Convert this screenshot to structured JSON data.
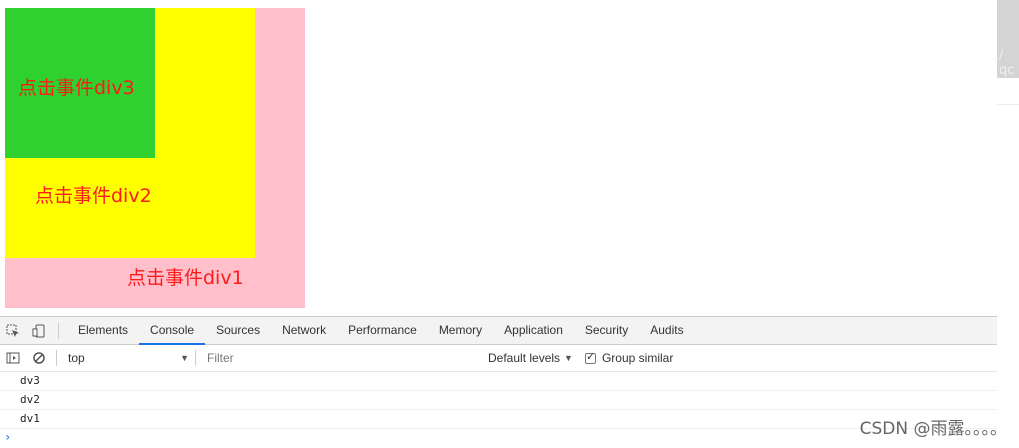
{
  "page": {
    "div3_label": "点击事件div3",
    "div2_label": "点击事件div2",
    "div1_label": "点击事件div1",
    "side_text": "/ qc"
  },
  "devtools": {
    "tabs": [
      {
        "label": "Elements"
      },
      {
        "label": "Console",
        "active": true
      },
      {
        "label": "Sources"
      },
      {
        "label": "Network"
      },
      {
        "label": "Performance"
      },
      {
        "label": "Memory"
      },
      {
        "label": "Application"
      },
      {
        "label": "Security"
      },
      {
        "label": "Audits"
      }
    ],
    "toolbar": {
      "context": "top",
      "filter_placeholder": "Filter",
      "levels": "Default levels",
      "group_similar": "Group similar"
    },
    "log": [
      "dv3",
      "dv2",
      "dv1"
    ],
    "prompt": "›"
  },
  "watermark": "CSDN @雨露。。。。",
  "colors": {
    "div1": "#ffc0cb",
    "div2": "#ffff00",
    "div3": "#2fd12f",
    "label": "#ff1a1a",
    "accent": "#1a73e8"
  }
}
